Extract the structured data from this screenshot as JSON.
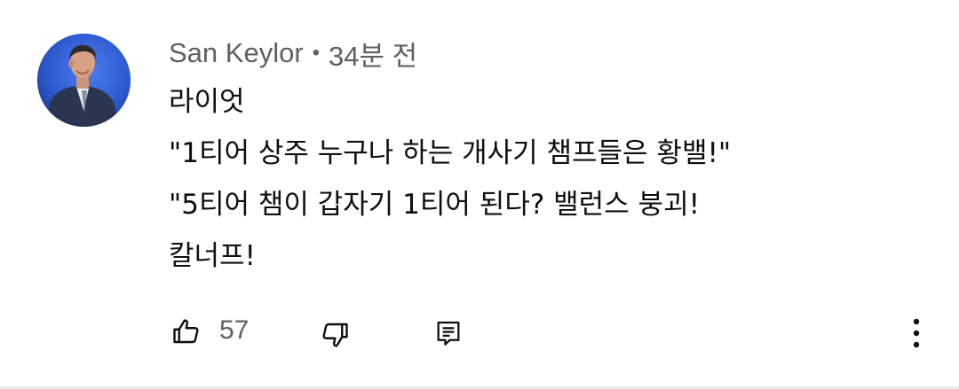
{
  "comment": {
    "author": "San Keylor",
    "separator": "•",
    "time": "34분 전",
    "lines": [
      "라이엇",
      "\"1티어 상주 누구나 하는 개사기 챔프들은 황밸!\"",
      "\"5티어 챔이 갑자기 1티어 된다? 밸런스 붕괴!",
      "칼너프!"
    ],
    "like_count": "57"
  },
  "icons": {
    "avatar": "avatar-photo",
    "like": "thumbs-up-icon",
    "dislike": "thumbs-down-icon",
    "reply": "reply-comment-icon",
    "more": "more-vertical-icon"
  },
  "colors": {
    "primary_text": "#0f0f0f",
    "secondary_text": "#606060",
    "avatar_bg": "#2f5bd1"
  }
}
